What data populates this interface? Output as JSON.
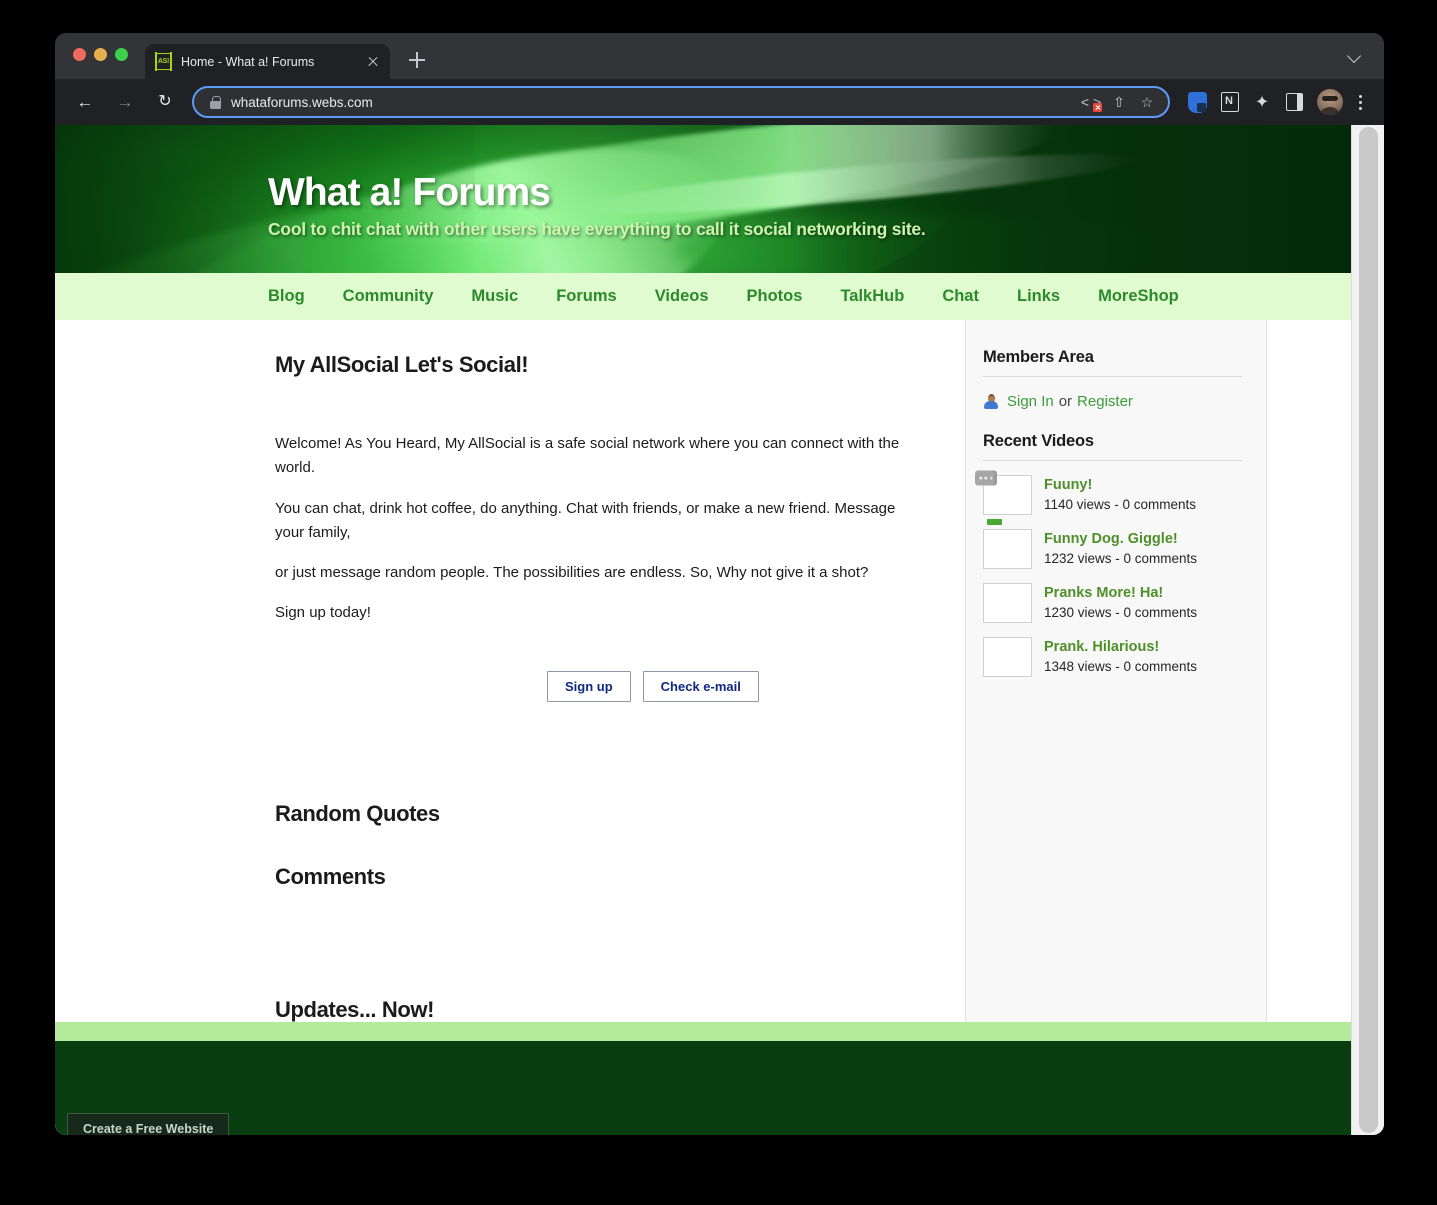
{
  "browser": {
    "tab": {
      "title": "Home - What a! Forums",
      "favicon_text": "AS!",
      "favicon_name": "allsocial-favicon"
    },
    "omnibox": {
      "url": "whataforums.webs.com",
      "lock_icon": "lock-icon",
      "code_icon": "code-blocked-icon",
      "share_icon": "share-icon",
      "bookmark_icon": "star-icon"
    },
    "nav": {
      "back": "←",
      "forward": "→",
      "reload": "↻"
    },
    "extensions": [
      {
        "name": "shield-lock-extension-icon"
      },
      {
        "name": "notion-extension-icon"
      },
      {
        "name": "puzzle-extensions-icon",
        "glyph": "❦"
      },
      {
        "name": "side-panel-icon"
      }
    ],
    "profile_icon": "profile-avatar",
    "menu_icon": "three-dot-menu-icon",
    "new_tab_icon": "new-tab-icon",
    "tab_list_icon": "tab-search-chevron-icon"
  },
  "site": {
    "title": "What a! Forums",
    "tagline": "Cool to chit chat with other users have everything to call it social networking site.",
    "nav": [
      "Blog",
      "Community",
      "Music",
      "Forums",
      "Videos",
      "Photos",
      "TalkHub",
      "Chat",
      "Links",
      "MoreShop"
    ],
    "colors": {
      "banner_dark": "#073d0c",
      "nav_bg": "#e0fbd0",
      "nav_link": "#2c8a2c",
      "footer_strip": "#b3eb9a",
      "footer_bg": "#0a3d0f",
      "side_link": "#3a9c3a",
      "video_link": "#4f8f2a",
      "button_text": "#102a83"
    }
  },
  "main": {
    "heading": "My AllSocial Let's Social!",
    "paragraphs": [
      "Welcome! As You Heard, My AllSocial is a safe social network where you can connect with the world.",
      "You can chat, drink hot coffee, do anything. Chat with friends, or make a new friend. Message your family,",
      "or just message random people. The possibilities are endless. So, Why not give it a shot?",
      "Sign up today!"
    ],
    "buttons": {
      "signup": "Sign up",
      "check_email": "Check e-mail"
    },
    "sections": {
      "quotes": "Random Quotes",
      "comments": "Comments",
      "updates": "Updates... Now!"
    }
  },
  "sidebar": {
    "members_heading": "Members Area",
    "sign_in": "Sign In",
    "or": "or",
    "register": "Register",
    "person_icon": "member-person-icon",
    "videos_heading": "Recent Videos",
    "videos": [
      {
        "title": "Fuuny!",
        "stats": "1140 views - 0 comments",
        "thumb": "placeholder-thumbnail"
      },
      {
        "title": "Funny Dog. Giggle!",
        "stats": "1232 views - 0 comments",
        "thumb": "dog-thumbnail"
      },
      {
        "title": "Pranks More! Ha!",
        "stats": "1230 views - 0 comments",
        "thumb": "park-thumbnail"
      },
      {
        "title": "Prank. Hilarious!",
        "stats": "1348 views - 0 comments",
        "thumb": "hallway-thumbnail"
      }
    ]
  },
  "footer": {
    "create_site": "Create a Free Website"
  }
}
